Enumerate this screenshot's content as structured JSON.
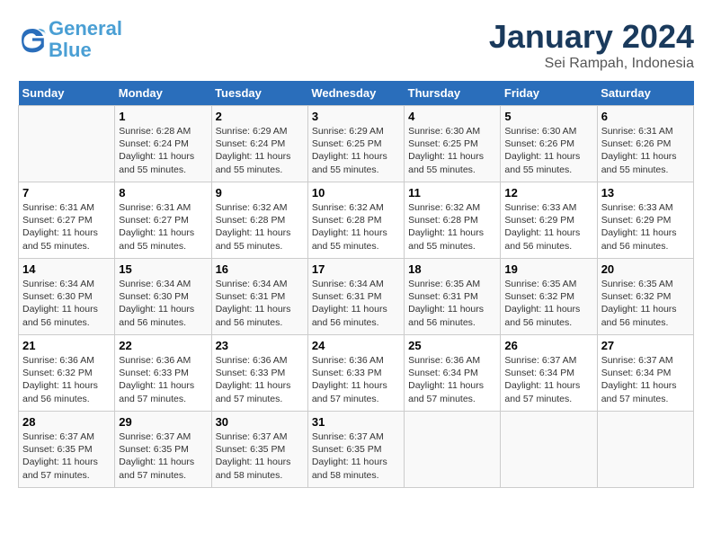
{
  "header": {
    "logo_line1": "General",
    "logo_line2": "Blue",
    "month_title": "January 2024",
    "location": "Sei Rampah, Indonesia"
  },
  "days_of_week": [
    "Sunday",
    "Monday",
    "Tuesday",
    "Wednesday",
    "Thursday",
    "Friday",
    "Saturday"
  ],
  "weeks": [
    [
      {
        "day": "",
        "info": ""
      },
      {
        "day": "1",
        "info": "Sunrise: 6:28 AM\nSunset: 6:24 PM\nDaylight: 11 hours\nand 55 minutes."
      },
      {
        "day": "2",
        "info": "Sunrise: 6:29 AM\nSunset: 6:24 PM\nDaylight: 11 hours\nand 55 minutes."
      },
      {
        "day": "3",
        "info": "Sunrise: 6:29 AM\nSunset: 6:25 PM\nDaylight: 11 hours\nand 55 minutes."
      },
      {
        "day": "4",
        "info": "Sunrise: 6:30 AM\nSunset: 6:25 PM\nDaylight: 11 hours\nand 55 minutes."
      },
      {
        "day": "5",
        "info": "Sunrise: 6:30 AM\nSunset: 6:26 PM\nDaylight: 11 hours\nand 55 minutes."
      },
      {
        "day": "6",
        "info": "Sunrise: 6:31 AM\nSunset: 6:26 PM\nDaylight: 11 hours\nand 55 minutes."
      }
    ],
    [
      {
        "day": "7",
        "info": "Sunrise: 6:31 AM\nSunset: 6:27 PM\nDaylight: 11 hours\nand 55 minutes."
      },
      {
        "day": "8",
        "info": "Sunrise: 6:31 AM\nSunset: 6:27 PM\nDaylight: 11 hours\nand 55 minutes."
      },
      {
        "day": "9",
        "info": "Sunrise: 6:32 AM\nSunset: 6:28 PM\nDaylight: 11 hours\nand 55 minutes."
      },
      {
        "day": "10",
        "info": "Sunrise: 6:32 AM\nSunset: 6:28 PM\nDaylight: 11 hours\nand 55 minutes."
      },
      {
        "day": "11",
        "info": "Sunrise: 6:32 AM\nSunset: 6:28 PM\nDaylight: 11 hours\nand 55 minutes."
      },
      {
        "day": "12",
        "info": "Sunrise: 6:33 AM\nSunset: 6:29 PM\nDaylight: 11 hours\nand 56 minutes."
      },
      {
        "day": "13",
        "info": "Sunrise: 6:33 AM\nSunset: 6:29 PM\nDaylight: 11 hours\nand 56 minutes."
      }
    ],
    [
      {
        "day": "14",
        "info": "Sunrise: 6:34 AM\nSunset: 6:30 PM\nDaylight: 11 hours\nand 56 minutes."
      },
      {
        "day": "15",
        "info": "Sunrise: 6:34 AM\nSunset: 6:30 PM\nDaylight: 11 hours\nand 56 minutes."
      },
      {
        "day": "16",
        "info": "Sunrise: 6:34 AM\nSunset: 6:31 PM\nDaylight: 11 hours\nand 56 minutes."
      },
      {
        "day": "17",
        "info": "Sunrise: 6:34 AM\nSunset: 6:31 PM\nDaylight: 11 hours\nand 56 minutes."
      },
      {
        "day": "18",
        "info": "Sunrise: 6:35 AM\nSunset: 6:31 PM\nDaylight: 11 hours\nand 56 minutes."
      },
      {
        "day": "19",
        "info": "Sunrise: 6:35 AM\nSunset: 6:32 PM\nDaylight: 11 hours\nand 56 minutes."
      },
      {
        "day": "20",
        "info": "Sunrise: 6:35 AM\nSunset: 6:32 PM\nDaylight: 11 hours\nand 56 minutes."
      }
    ],
    [
      {
        "day": "21",
        "info": "Sunrise: 6:36 AM\nSunset: 6:32 PM\nDaylight: 11 hours\nand 56 minutes."
      },
      {
        "day": "22",
        "info": "Sunrise: 6:36 AM\nSunset: 6:33 PM\nDaylight: 11 hours\nand 57 minutes."
      },
      {
        "day": "23",
        "info": "Sunrise: 6:36 AM\nSunset: 6:33 PM\nDaylight: 11 hours\nand 57 minutes."
      },
      {
        "day": "24",
        "info": "Sunrise: 6:36 AM\nSunset: 6:33 PM\nDaylight: 11 hours\nand 57 minutes."
      },
      {
        "day": "25",
        "info": "Sunrise: 6:36 AM\nSunset: 6:34 PM\nDaylight: 11 hours\nand 57 minutes."
      },
      {
        "day": "26",
        "info": "Sunrise: 6:37 AM\nSunset: 6:34 PM\nDaylight: 11 hours\nand 57 minutes."
      },
      {
        "day": "27",
        "info": "Sunrise: 6:37 AM\nSunset: 6:34 PM\nDaylight: 11 hours\nand 57 minutes."
      }
    ],
    [
      {
        "day": "28",
        "info": "Sunrise: 6:37 AM\nSunset: 6:35 PM\nDaylight: 11 hours\nand 57 minutes."
      },
      {
        "day": "29",
        "info": "Sunrise: 6:37 AM\nSunset: 6:35 PM\nDaylight: 11 hours\nand 57 minutes."
      },
      {
        "day": "30",
        "info": "Sunrise: 6:37 AM\nSunset: 6:35 PM\nDaylight: 11 hours\nand 58 minutes."
      },
      {
        "day": "31",
        "info": "Sunrise: 6:37 AM\nSunset: 6:35 PM\nDaylight: 11 hours\nand 58 minutes."
      },
      {
        "day": "",
        "info": ""
      },
      {
        "day": "",
        "info": ""
      },
      {
        "day": "",
        "info": ""
      }
    ]
  ]
}
